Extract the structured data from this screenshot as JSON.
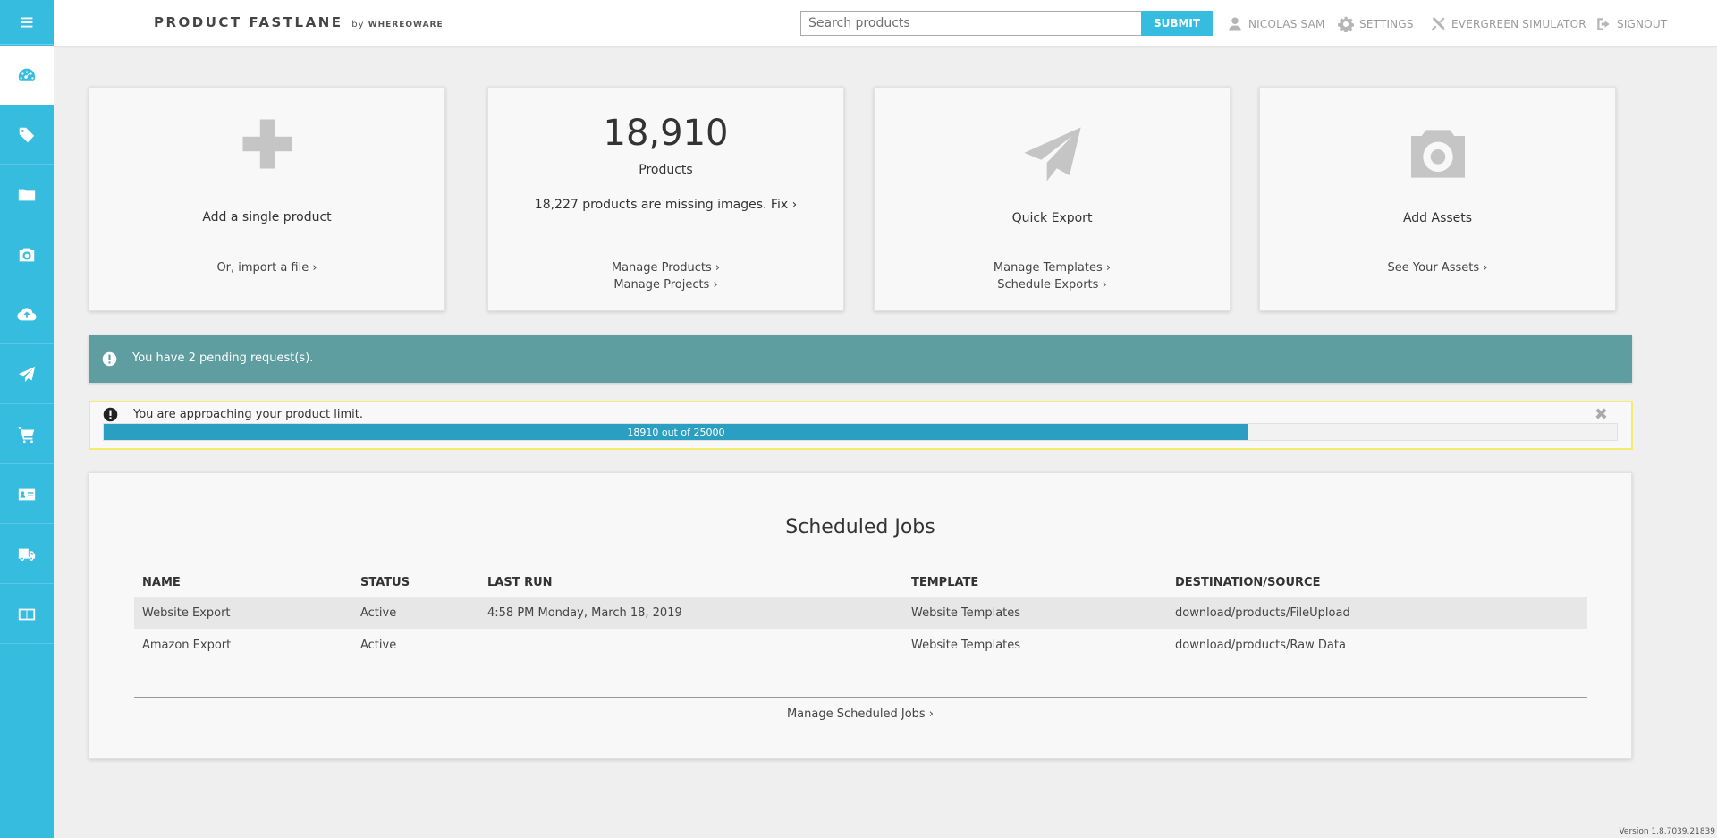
{
  "header": {
    "brand": "PRODUCT FASTLANE",
    "brand_by": "by",
    "brand_company": "WHEREOWARE",
    "search_placeholder": "Search products",
    "submit_label": "SUBMIT",
    "user_label": "NICOLAS SAM",
    "settings_label": "SETTINGS",
    "simulator_label": "EVERGREEN SIMULATOR",
    "signout_label": "SIGNOUT"
  },
  "sidebar": {
    "items": [
      {
        "icon": "menu-icon"
      },
      {
        "icon": "dashboard-icon",
        "active": true
      },
      {
        "icon": "tag-icon"
      },
      {
        "icon": "folder-icon"
      },
      {
        "icon": "camera-icon"
      },
      {
        "icon": "cloud-upload-icon"
      },
      {
        "icon": "paper-plane-icon"
      },
      {
        "icon": "cart-icon"
      },
      {
        "icon": "id-card-icon"
      },
      {
        "icon": "truck-icon"
      },
      {
        "icon": "book-icon"
      }
    ]
  },
  "cards": {
    "add_product": {
      "caption": "Add a single product",
      "link": "Or, import a file  ›"
    },
    "products": {
      "count": "18,910",
      "label": "Products",
      "missing": "18,227 products are missing images. Fix ›",
      "link1": "Manage Products  ›",
      "link2": "Manage Projects  ›"
    },
    "export": {
      "caption": "Quick Export",
      "link1": "Manage Templates ›",
      "link2": "Schedule Exports ›"
    },
    "assets": {
      "caption": "Add Assets",
      "link": "See Your Assets ›"
    }
  },
  "alerts": {
    "pending": "You have 2 pending request(s).",
    "limit_msg": "You are approaching your product limit.",
    "close": "✖",
    "progress_text": "18910 out of 25000",
    "progress_value": 18910,
    "progress_max": 25000
  },
  "jobs": {
    "title": "Scheduled Jobs",
    "columns": [
      "NAME",
      "STATUS",
      "LAST RUN",
      "TEMPLATE",
      "DESTINATION/SOURCE"
    ],
    "rows": [
      [
        "Website Export",
        "Active",
        "4:58 PM Monday, March 18, 2019",
        "Website Templates",
        "download/products/FileUpload"
      ],
      [
        "Amazon Export",
        "Active",
        "",
        "Website Templates",
        "download/products/Raw Data"
      ]
    ],
    "manage_link": "Manage Scheduled Jobs ›"
  },
  "version": "Version 1.8.7039.21839",
  "colors": {
    "accent": "#36bcdf",
    "pending_bg": "#5f9ea0",
    "progress": "#2b9fc1",
    "warning_border": "#f4ec6c"
  }
}
